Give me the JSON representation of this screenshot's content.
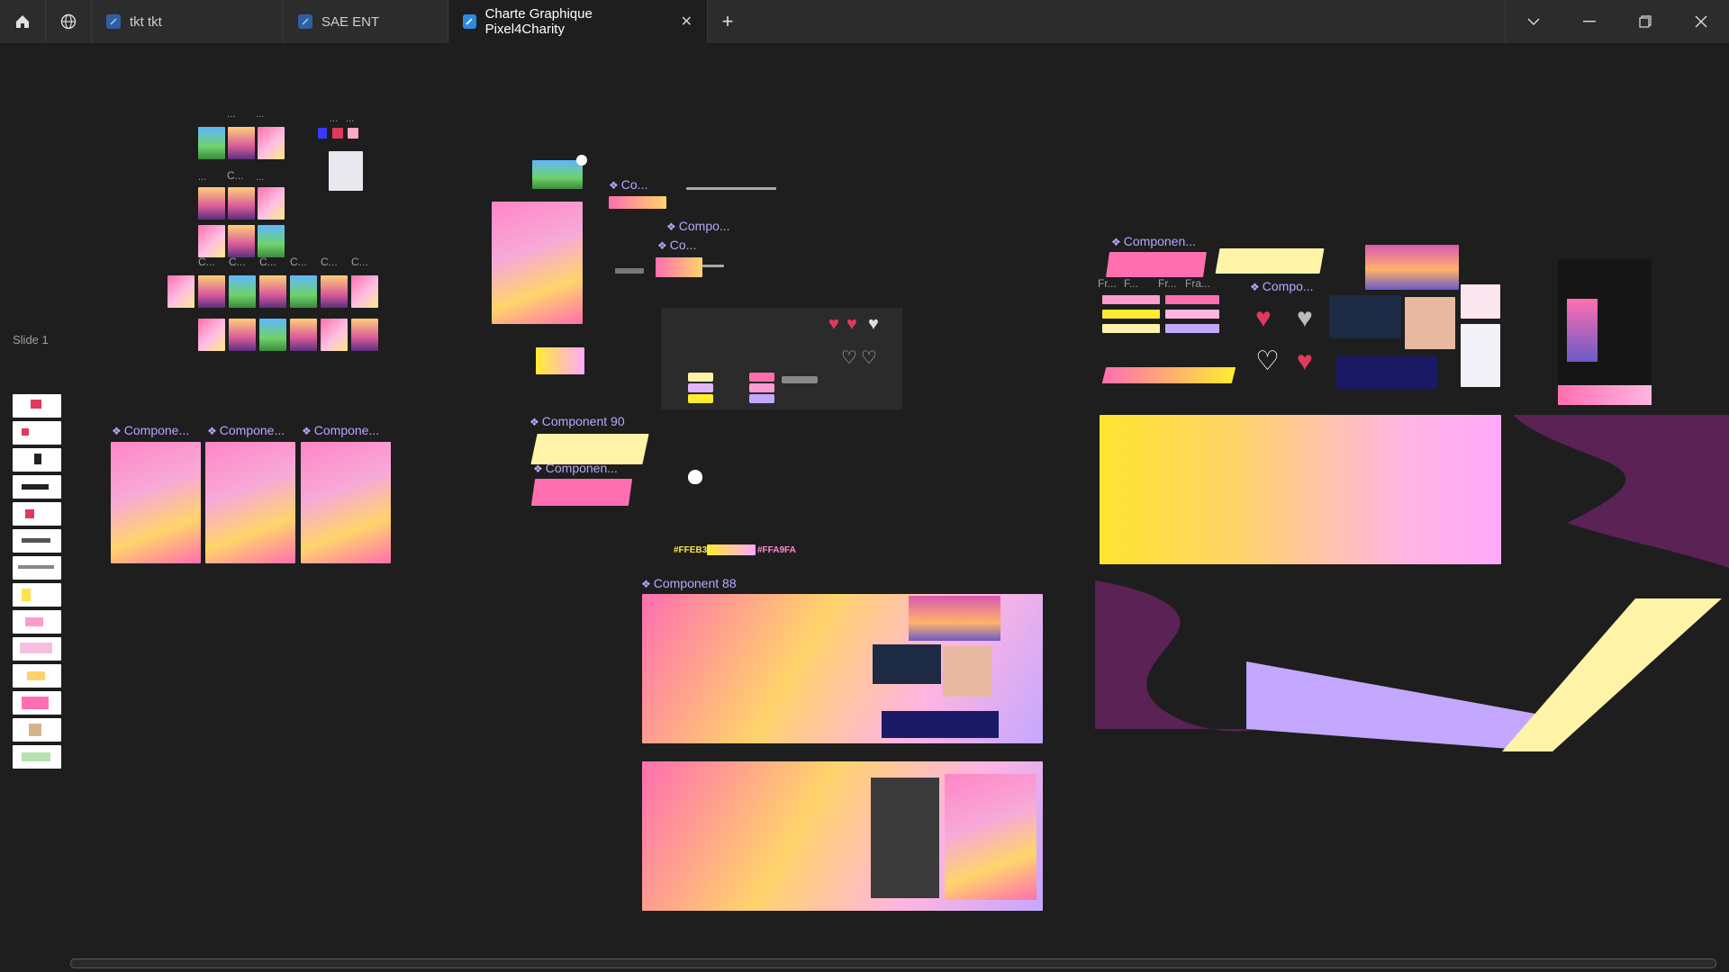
{
  "titlebar": {
    "home_icon": "home-icon",
    "globe_icon": "globe-icon",
    "tabs": [
      {
        "label": "tkt tkt",
        "active": false
      },
      {
        "label": "SAE ENT",
        "active": false
      },
      {
        "label": "Charte Graphique Pixel4Charity",
        "active": true
      }
    ],
    "close_glyph": "✕",
    "new_tab_glyph": "+",
    "window_controls": [
      "chevron-down-icon",
      "minimize-icon",
      "restore-icon",
      "close-icon"
    ]
  },
  "canvas": {
    "slide_label": "Slide 1",
    "frame_labels": {
      "top_dots_a": "...",
      "top_dots_b": "...",
      "top_dots_c": "...",
      "top_dots_d": "...",
      "c_dots_1": "...",
      "c_label": "C...",
      "c_dots_2": "...",
      "c_row": [
        "C...",
        "C...",
        "C...",
        "C...",
        "C...",
        "C..."
      ],
      "poster_comp_1": "Compone...",
      "poster_comp_2": "Compone...",
      "poster_comp_3": "Compone...",
      "co_1": "Co...",
      "compo_1": "Compo...",
      "co_2": "Co...",
      "component_90": "Component 90",
      "componen_small": "Componen...",
      "component_88": "Component 88",
      "componen_right": "Componen...",
      "compo_right": "Compo...",
      "fr_row": [
        "Fr...",
        "F...",
        "Fr...",
        "Fra..."
      ]
    },
    "swatches": {
      "yellow_hex": "#FFEB32",
      "pink_hex": "#FFA9FA"
    },
    "colors": {
      "canvas_bg": "#1e1e1e",
      "accent_purple": "#b9a6ff",
      "brand_pink": "#ff6fb0",
      "brand_yellow": "#ffeb32",
      "deep_purple": "#5a2255",
      "lavender": "#c4a7ff",
      "pale_yellow": "#fff3a8"
    }
  }
}
